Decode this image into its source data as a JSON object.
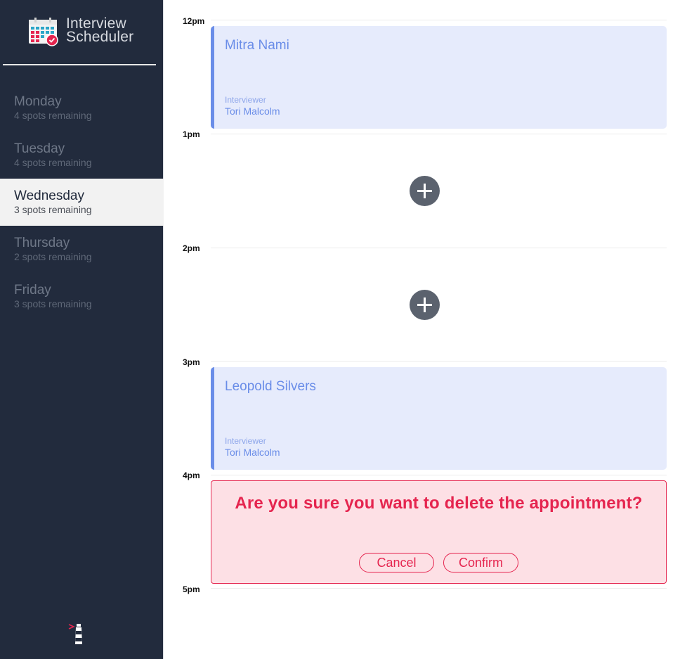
{
  "app": {
    "title_line1": "Interview",
    "title_line2": "Scheduler",
    "logo_icon": "calendar-check-icon",
    "footer_icon": "lighthouse-icon"
  },
  "sidebar": {
    "days": [
      {
        "name": "Monday",
        "spots": "4 spots remaining",
        "selected": false
      },
      {
        "name": "Tuesday",
        "spots": "4 spots remaining",
        "selected": false
      },
      {
        "name": "Wednesday",
        "spots": "3 spots remaining",
        "selected": true
      },
      {
        "name": "Thursday",
        "spots": "2 spots remaining",
        "selected": false
      },
      {
        "name": "Friday",
        "spots": "3 spots remaining",
        "selected": false
      }
    ]
  },
  "schedule": {
    "times": [
      "12pm",
      "1pm",
      "2pm",
      "3pm",
      "4pm",
      "5pm"
    ],
    "appointments": [
      {
        "time": "12pm",
        "student": "Mitra Nami",
        "interviewer_label": "Interviewer",
        "interviewer": "Tori Malcolm"
      },
      {
        "time": "1pm",
        "empty": true,
        "add_icon": "plus-icon"
      },
      {
        "time": "2pm",
        "empty": true,
        "add_icon": "plus-icon"
      },
      {
        "time": "3pm",
        "student": "Leopold Silvers",
        "interviewer_label": "Interviewer",
        "interviewer": "Tori Malcolm"
      }
    ],
    "confirm": {
      "time": "4pm",
      "message": "Are you sure you want to delete the appointment?",
      "cancel_label": "Cancel",
      "confirm_label": "Confirm"
    }
  },
  "colors": {
    "sidebar_bg": "#222b3d",
    "accent_blue": "#6a8de8",
    "danger": "#e5254f"
  }
}
